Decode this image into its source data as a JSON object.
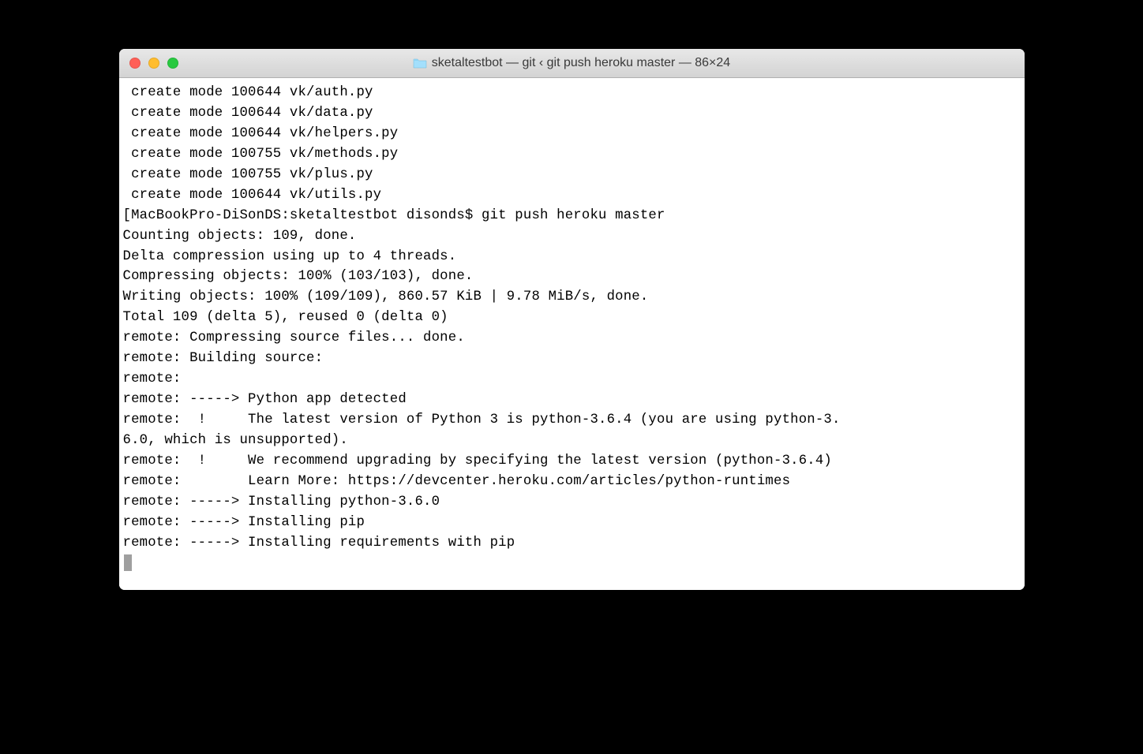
{
  "window": {
    "title": "sketaltestbot — git ‹ git push heroku master — 86×24"
  },
  "terminal": {
    "lines": [
      " create mode 100644 vk/auth.py",
      " create mode 100644 vk/data.py",
      " create mode 100644 vk/helpers.py",
      " create mode 100755 vk/methods.py",
      " create mode 100755 vk/plus.py",
      " create mode 100644 vk/utils.py",
      "[MacBookPro-DiSonDS:sketaltestbot disonds$ git push heroku master",
      "Counting objects: 109, done.",
      "Delta compression using up to 4 threads.",
      "Compressing objects: 100% (103/103), done.",
      "Writing objects: 100% (109/109), 860.57 KiB | 9.78 MiB/s, done.",
      "Total 109 (delta 5), reused 0 (delta 0)",
      "remote: Compressing source files... done.",
      "remote: Building source:",
      "remote:",
      "remote: -----> Python app detected",
      "remote:  !     The latest version of Python 3 is python-3.6.4 (you are using python-3.",
      "6.0, which is unsupported).",
      "remote:  !     We recommend upgrading by specifying the latest version (python-3.6.4)",
      "remote:        Learn More: https://devcenter.heroku.com/articles/python-runtimes",
      "remote: -----> Installing python-3.6.0",
      "remote: -----> Installing pip",
      "remote: -----> Installing requirements with pip"
    ]
  }
}
